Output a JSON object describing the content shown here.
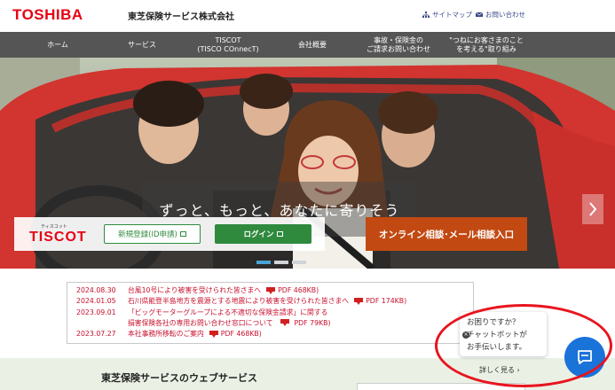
{
  "header": {
    "logo": "TOSHIBA",
    "company": "東芝保険サービス株式会社",
    "sitemap": "サイトマップ",
    "contact": "お問い合わせ"
  },
  "nav": [
    {
      "line1": "ホーム",
      "line2": ""
    },
    {
      "line1": "サービス",
      "line2": ""
    },
    {
      "line1": "TISCOT",
      "line2": "(TISCO COnnecT)"
    },
    {
      "line1": "会社概要",
      "line2": ""
    },
    {
      "line1": "事故・保険金の",
      "line2": "ご請求お問い合わせ"
    },
    {
      "line1": "\"つねにお客さまのこと",
      "line2": "を考える\"取り組み"
    }
  ],
  "hero": {
    "title": "ずっと、もっと、あなたに寄りそう"
  },
  "tiscot": {
    "ruby": "ティスコット",
    "logo": "TISCOT",
    "register_label": "新規登録(ID申請)",
    "login_label": "ログイン",
    "consult_label": "オンライン相談･メール相談入口"
  },
  "news": [
    {
      "date": "2024.08.30",
      "text": "台風10号により被害を受けられた皆さまへ",
      "pdf": "PDF 468KB)"
    },
    {
      "date": "2024.01.05",
      "text": "石川県能登半島地方を震源とする地震により被害を受けられた皆さまへ",
      "pdf": "PDF 174KB)"
    },
    {
      "date": "2023.09.01",
      "text": "「ビッグモーターグループによる不適切な保険金請求」に関する",
      "pdf": ""
    },
    {
      "date": "",
      "text": "損害保険各社の専用お問い合わせ窓口について",
      "pdf": "PDF 79KB)"
    },
    {
      "date": "2023.07.27",
      "text": "本社事務所移転のご案内",
      "pdf": "PDF 468KB)"
    }
  ],
  "bottom": {
    "title": "東芝保険サービスのウェブサービス",
    "more": "詳しく見る ›"
  },
  "chat": {
    "line1": "お困りですか？",
    "line2": "チャットボットが",
    "line3": "お手伝いします。",
    "close": "×"
  },
  "colors": {
    "brand_red": "#e60012",
    "nav_bg": "#555555",
    "login_green": "#2f8a3e",
    "consult_orange": "#c24a12",
    "chat_blue": "#1a73d9"
  }
}
